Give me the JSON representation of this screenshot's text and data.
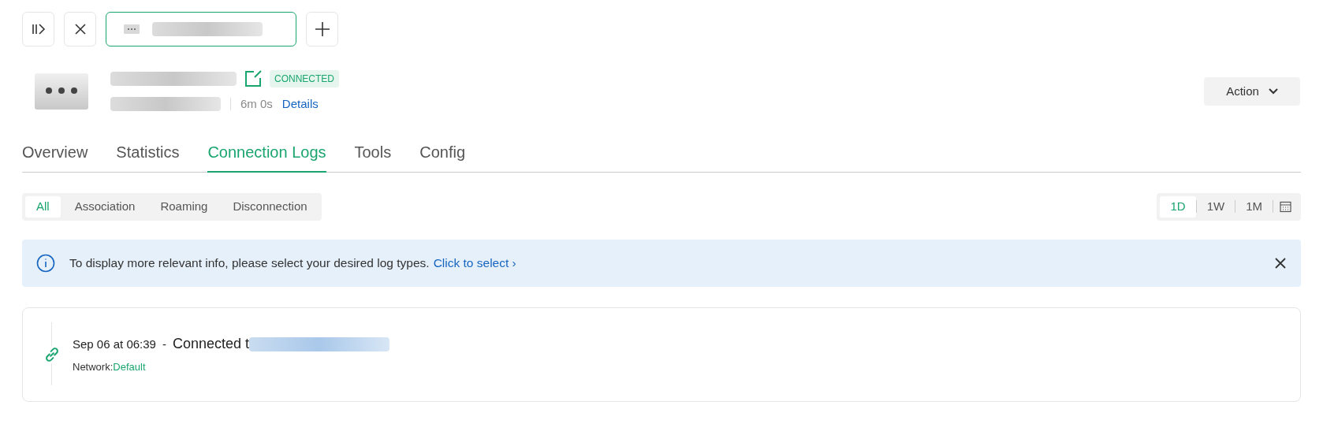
{
  "toolbar": {
    "buttons": [
      {
        "kind": "collapse"
      },
      {
        "kind": "close"
      }
    ],
    "device_tab": {
      "selected": true
    },
    "add_button": {
      "kind": "add"
    }
  },
  "device": {
    "status": "CONNECTED",
    "uptime": "6m 0s",
    "details_link": "Details",
    "action_button": "Action"
  },
  "tabs": [
    {
      "label": "Overview",
      "selected": false
    },
    {
      "label": "Statistics",
      "selected": false
    },
    {
      "label": "Connection Logs",
      "selected": true
    },
    {
      "label": "Tools",
      "selected": false
    },
    {
      "label": "Config",
      "selected": false
    }
  ],
  "log_filters": [
    {
      "label": "All",
      "selected": true
    },
    {
      "label": "Association",
      "selected": false
    },
    {
      "label": "Roaming",
      "selected": false
    },
    {
      "label": "Disconnection",
      "selected": false
    }
  ],
  "ranges": [
    {
      "label": "1D",
      "selected": true
    },
    {
      "label": "1W",
      "selected": false
    },
    {
      "label": "1M",
      "selected": false
    }
  ],
  "banner": {
    "text": "To display more relevant info, please select your desired log types.",
    "link": "Click to select ›"
  },
  "logs": [
    {
      "time": "Sep 06 at 06:39",
      "separator": "-",
      "event": "Connected t",
      "network_label": "Network:",
      "network": "Default"
    }
  ]
}
